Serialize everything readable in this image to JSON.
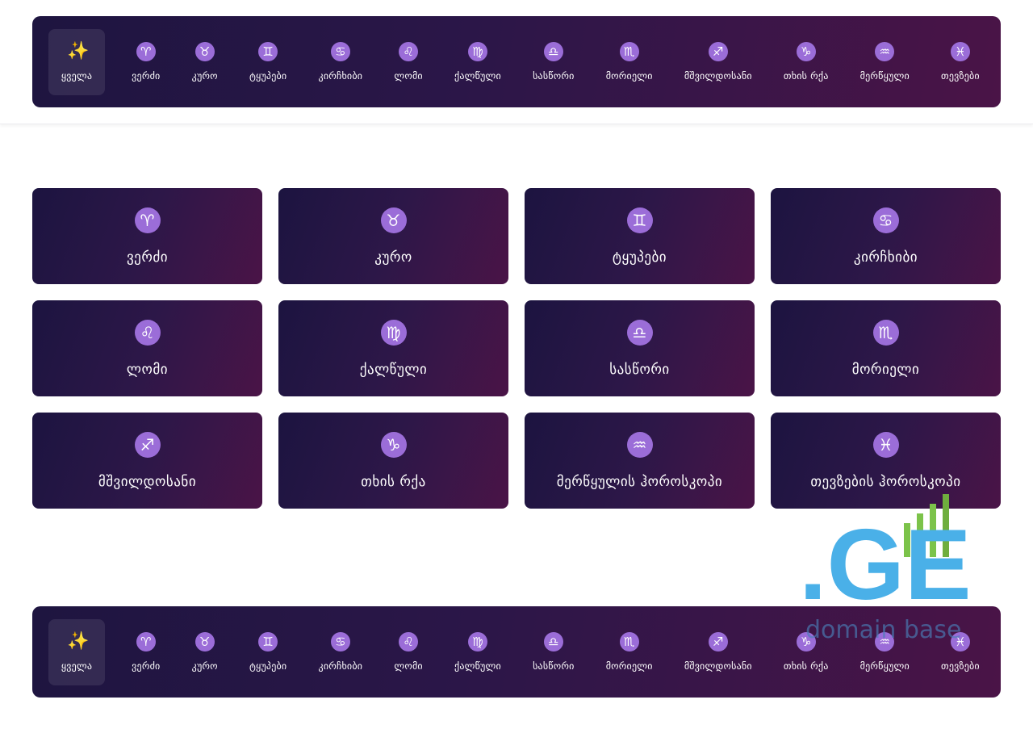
{
  "nav": {
    "items": [
      {
        "icon": "sparkles-icon",
        "glyph": "✨",
        "label": "ყველა",
        "active": true
      },
      {
        "icon": "aries-icon",
        "glyph": "♈",
        "label": "ვერძი"
      },
      {
        "icon": "taurus-icon",
        "glyph": "♉",
        "label": "კურო"
      },
      {
        "icon": "gemini-icon",
        "glyph": "♊",
        "label": "ტყუპები"
      },
      {
        "icon": "cancer-icon",
        "glyph": "♋",
        "label": "კირჩხიბი"
      },
      {
        "icon": "leo-icon",
        "glyph": "♌",
        "label": "ლომი"
      },
      {
        "icon": "virgo-icon",
        "glyph": "♍",
        "label": "ქალწული"
      },
      {
        "icon": "libra-icon",
        "glyph": "♎",
        "label": "სასწორი"
      },
      {
        "icon": "scorpio-icon",
        "glyph": "♏",
        "label": "მორიელი"
      },
      {
        "icon": "sagittarius-icon",
        "glyph": "♐",
        "label": "მშვილდოსანი"
      },
      {
        "icon": "capricorn-icon",
        "glyph": "♑",
        "label": "თხის რქა"
      },
      {
        "icon": "aquarius-icon",
        "glyph": "♒",
        "label": "მერწყული"
      },
      {
        "icon": "pisces-icon",
        "glyph": "♓",
        "label": "თევზები"
      }
    ]
  },
  "cards": [
    {
      "icon": "aries-icon",
      "glyph": "♈",
      "label": "ვერძი"
    },
    {
      "icon": "taurus-icon",
      "glyph": "♉",
      "label": "კურო"
    },
    {
      "icon": "gemini-icon",
      "glyph": "♊",
      "label": "ტყუპები"
    },
    {
      "icon": "cancer-icon",
      "glyph": "♋",
      "label": "კირჩხიბი"
    },
    {
      "icon": "leo-icon",
      "glyph": "♌",
      "label": "ლომი"
    },
    {
      "icon": "virgo-icon",
      "glyph": "♍",
      "label": "ქალწული"
    },
    {
      "icon": "libra-icon",
      "glyph": "♎",
      "label": "სასწორი"
    },
    {
      "icon": "scorpio-icon",
      "glyph": "♏",
      "label": "მორიელი"
    },
    {
      "icon": "sagittarius-icon",
      "glyph": "♐",
      "label": "მშვილდოსანი"
    },
    {
      "icon": "capricorn-icon",
      "glyph": "♑",
      "label": "თხის რქა"
    },
    {
      "icon": "aquarius-icon",
      "glyph": "♒",
      "label": "მერწყულის ჰოროსკოპი"
    },
    {
      "icon": "pisces-icon",
      "glyph": "♓",
      "label": "თევზების ჰოროსკოპი"
    }
  ],
  "watermark": {
    "logo_text": ".GE",
    "caption": "domain base"
  },
  "colors": {
    "accent": "#9b6dd8",
    "sparkle": "#ffc83d",
    "panel_start": "#1e1540",
    "panel_end": "#4a1447",
    "watermark_blue": "#4ab0e8",
    "watermark_green": "#7cc34a"
  }
}
